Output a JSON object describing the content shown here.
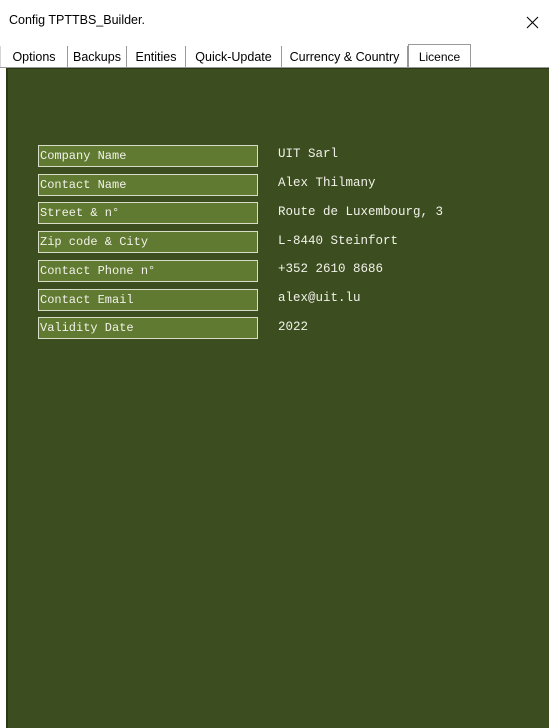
{
  "window": {
    "title": "Config TPTTBS_Builder.",
    "close_icon": "close-icon"
  },
  "tabs": [
    {
      "label": "Options",
      "active": false
    },
    {
      "label": "Backups",
      "active": false
    },
    {
      "label": "Entities",
      "active": false
    },
    {
      "label": "Quick-Update",
      "active": false
    },
    {
      "label": "Currency & Country",
      "active": false
    },
    {
      "label": "Licence",
      "active": true
    }
  ],
  "licence": {
    "fields": [
      {
        "label": "Company Name",
        "value": "UIT Sarl"
      },
      {
        "label": "Contact Name",
        "value": "Alex Thilmany"
      },
      {
        "label": "Street & n°",
        "value": "Route de Luxembourg, 3"
      },
      {
        "label": "Zip code & City",
        "value": "L-8440 Steinfort"
      },
      {
        "label": "Contact Phone n°",
        "value": "+352 2610 8686"
      },
      {
        "label": "Contact Email",
        "value": "alex@uit.lu"
      },
      {
        "label": "Validity Date",
        "value": "2022"
      }
    ]
  },
  "colors": {
    "panel_background": "#3c4d1f",
    "label_background": "#607a31",
    "text": "#f2f2ea"
  }
}
